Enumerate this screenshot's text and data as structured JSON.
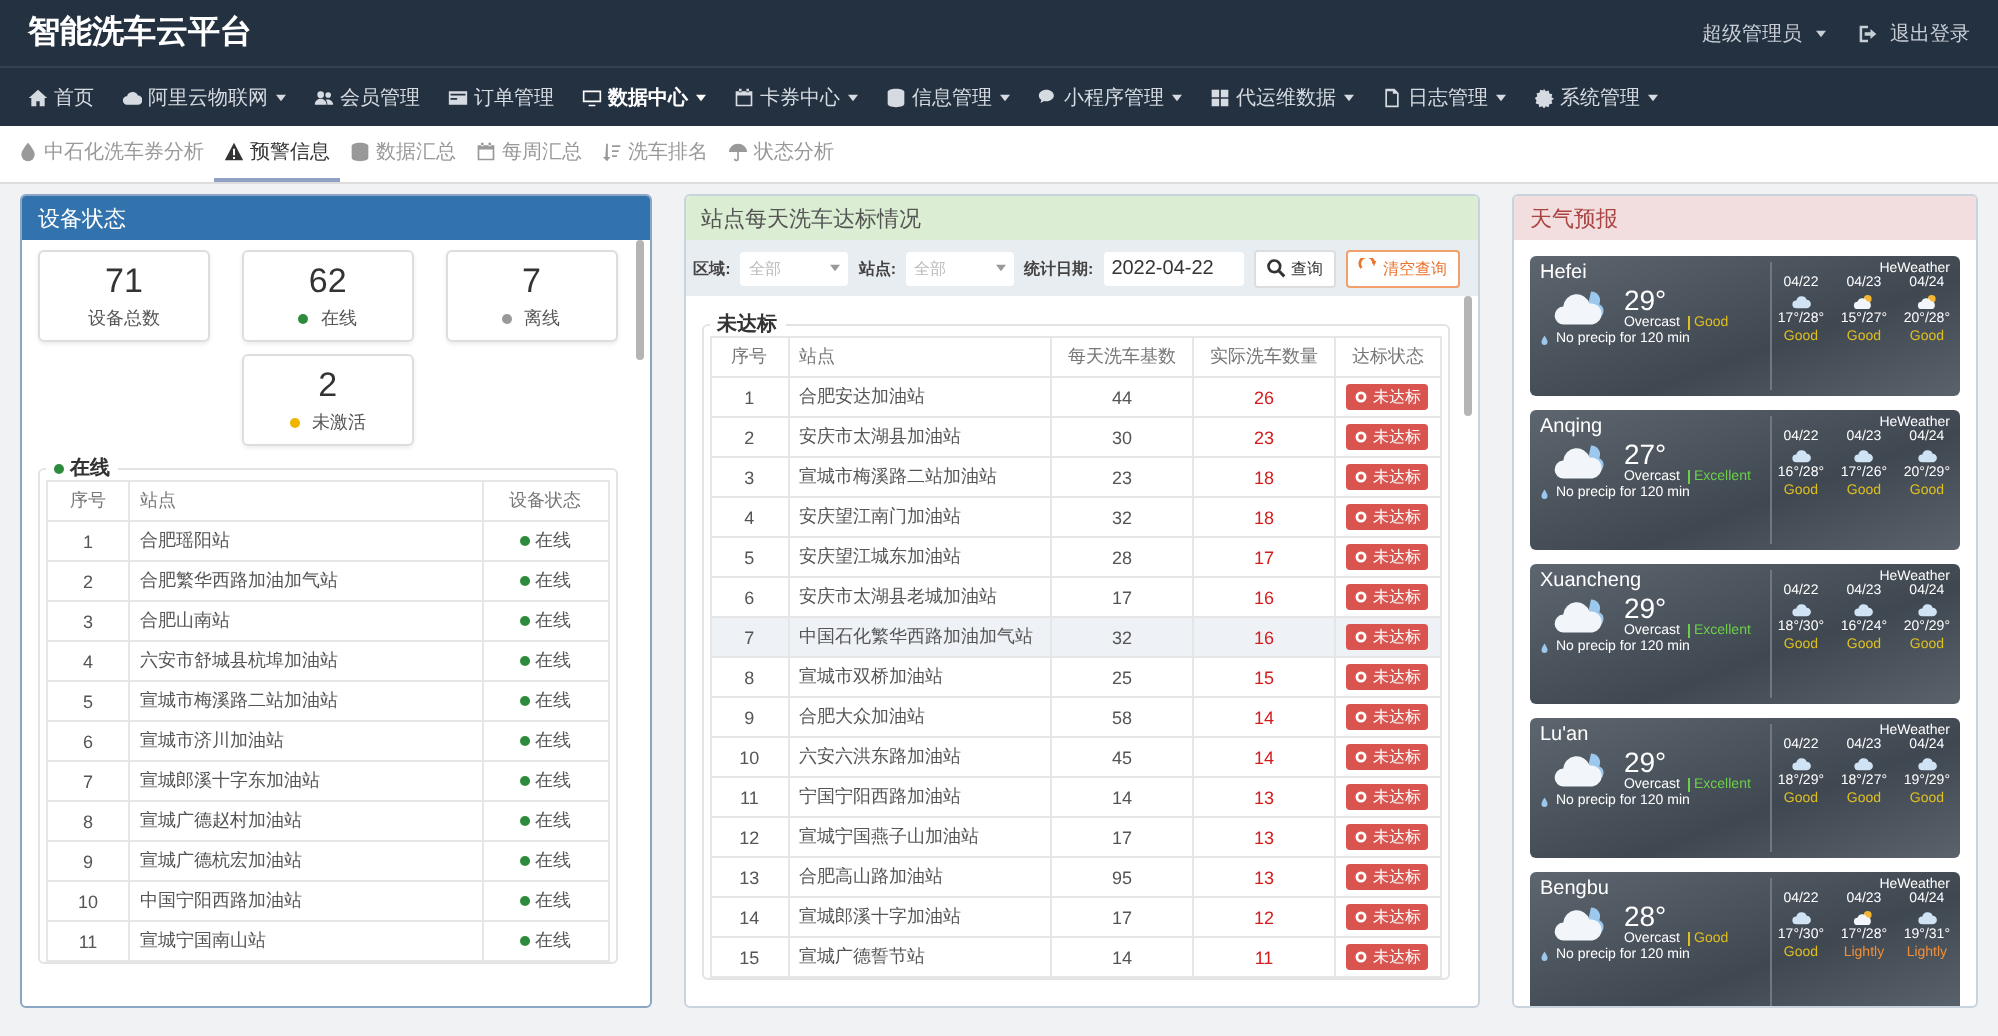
{
  "header": {
    "title": "智能洗车云平台",
    "user": "超级管理员",
    "logout": "退出登录"
  },
  "nav": [
    {
      "label": "首页",
      "active": false,
      "dropdown": false
    },
    {
      "label": "阿里云物联网",
      "active": false,
      "dropdown": true
    },
    {
      "label": "会员管理",
      "active": false,
      "dropdown": false
    },
    {
      "label": "订单管理",
      "active": false,
      "dropdown": false
    },
    {
      "label": "数据中心",
      "active": true,
      "dropdown": true
    },
    {
      "label": "卡券中心",
      "active": false,
      "dropdown": true
    },
    {
      "label": "信息管理",
      "active": false,
      "dropdown": true
    },
    {
      "label": "小程序管理",
      "active": false,
      "dropdown": true
    },
    {
      "label": "代运维数据",
      "active": false,
      "dropdown": true
    },
    {
      "label": "日志管理",
      "active": false,
      "dropdown": true
    },
    {
      "label": "系统管理",
      "active": false,
      "dropdown": true
    }
  ],
  "subtabs": [
    {
      "label": "中石化洗车券分析",
      "selected": false
    },
    {
      "label": "预警信息",
      "selected": true
    },
    {
      "label": "数据汇总",
      "selected": false
    },
    {
      "label": "每周汇总",
      "selected": false
    },
    {
      "label": "洗车排名",
      "selected": false
    },
    {
      "label": "状态分析",
      "selected": false
    }
  ],
  "device_panel": {
    "title": "设备状态",
    "stats": [
      {
        "value": "71",
        "label": "设备总数"
      },
      {
        "value": "62",
        "label": "在线",
        "color": "#2e8b3d"
      },
      {
        "value": "7",
        "label": "离线",
        "color": "#999999"
      },
      {
        "value": "2",
        "label": "未激活",
        "color": "#f0b400"
      }
    ],
    "legend": {
      "label": "在线",
      "color": "#2e8b3d"
    },
    "columns": [
      "序号",
      "站点",
      "设备状态"
    ],
    "rows": [
      {
        "no": "1",
        "station": "合肥瑶阳站",
        "status": "在线"
      },
      {
        "no": "2",
        "station": "合肥繁华西路加油加气站",
        "status": "在线"
      },
      {
        "no": "3",
        "station": "合肥山南站",
        "status": "在线"
      },
      {
        "no": "4",
        "station": "六安市舒城县杭埠加油站",
        "status": "在线"
      },
      {
        "no": "5",
        "station": "宣城市梅溪路二站加油站",
        "status": "在线"
      },
      {
        "no": "6",
        "station": "宣城市济川加油站",
        "status": "在线"
      },
      {
        "no": "7",
        "station": "宣城郎溪十字东加油站",
        "status": "在线"
      },
      {
        "no": "8",
        "station": "宣城广德赵村加油站",
        "status": "在线"
      },
      {
        "no": "9",
        "station": "宣城广德杭宏加油站",
        "status": "在线"
      },
      {
        "no": "10",
        "station": "中国宁阳西路加油站",
        "status": "在线"
      },
      {
        "no": "11",
        "station": "宣城宁国南山站",
        "status": "在线"
      }
    ]
  },
  "standard_panel": {
    "title": "站点每天洗车达标情况",
    "filters": {
      "region_label": "区域:",
      "region_value": "全部",
      "station_label": "站点:",
      "station_value": "全部",
      "date_label": "统计日期:",
      "date_value": "2022-04-22"
    },
    "search_button": "查询",
    "reset_button": "清空查询",
    "legend": "未达标",
    "columns": [
      "序号",
      "站点",
      "每天洗车基数",
      "实际洗车数量",
      "达标状态"
    ],
    "rows": [
      {
        "no": "1",
        "station": "合肥安达加油站",
        "target": "44",
        "actual": "26",
        "status": "未达标",
        "selected": false
      },
      {
        "no": "2",
        "station": "安庆市太湖县加油站",
        "target": "30",
        "actual": "23",
        "status": "未达标",
        "selected": false
      },
      {
        "no": "3",
        "station": "宣城市梅溪路二站加油站",
        "target": "23",
        "actual": "18",
        "status": "未达标",
        "selected": false
      },
      {
        "no": "4",
        "station": "安庆望江南门加油站",
        "target": "32",
        "actual": "18",
        "status": "未达标",
        "selected": false
      },
      {
        "no": "5",
        "station": "安庆望江城东加油站",
        "target": "28",
        "actual": "17",
        "status": "未达标",
        "selected": false
      },
      {
        "no": "6",
        "station": "安庆市太湖县老城加油站",
        "target": "17",
        "actual": "16",
        "status": "未达标",
        "selected": false
      },
      {
        "no": "7",
        "station": "中国石化繁华西路加油加气站",
        "target": "32",
        "actual": "16",
        "status": "未达标",
        "selected": true
      },
      {
        "no": "8",
        "station": "宣城市双桥加油站",
        "target": "25",
        "actual": "15",
        "status": "未达标",
        "selected": false
      },
      {
        "no": "9",
        "station": "合肥大众加油站",
        "target": "58",
        "actual": "14",
        "status": "未达标",
        "selected": false
      },
      {
        "no": "10",
        "station": "六安六洪东路加油站",
        "target": "45",
        "actual": "14",
        "status": "未达标",
        "selected": false
      },
      {
        "no": "11",
        "station": "宁国宁阳西路加油站",
        "target": "14",
        "actual": "13",
        "status": "未达标",
        "selected": false
      },
      {
        "no": "12",
        "station": "宣城宁国燕子山加油站",
        "target": "17",
        "actual": "13",
        "status": "未达标",
        "selected": false
      },
      {
        "no": "13",
        "station": "合肥高山路加油站",
        "target": "95",
        "actual": "13",
        "status": "未达标",
        "selected": false
      },
      {
        "no": "14",
        "station": "宣城郎溪十字加油站",
        "target": "17",
        "actual": "12",
        "status": "未达标",
        "selected": false
      },
      {
        "no": "15",
        "station": "宣城广德誓节站",
        "target": "14",
        "actual": "11",
        "status": "未达标",
        "selected": false
      }
    ]
  },
  "weather_panel": {
    "title": "天气预报",
    "cards": [
      {
        "city": "Hefei",
        "provider": "HeWeather",
        "temp": "29°",
        "condition": "Overcast",
        "aqi": "Good",
        "color": "#e0c020",
        "precip": "No precip for 120 min",
        "days": [
          {
            "date": "04/22",
            "kind": "cloudy",
            "range": "17°/28°",
            "aqi": "Good",
            "color": "#e0c020"
          },
          {
            "date": "04/23",
            "kind": "partly_cloudy",
            "range": "15°/27°",
            "aqi": "Good",
            "color": "#e0c020"
          },
          {
            "date": "04/24",
            "kind": "partly_cloudy",
            "range": "20°/28°",
            "aqi": "Good",
            "color": "#e0c020"
          }
        ]
      },
      {
        "city": "Anqing",
        "provider": "HeWeather",
        "temp": "27°",
        "condition": "Overcast",
        "aqi": "Excellent",
        "color": "#6ccf4a",
        "precip": "No precip for 120 min",
        "days": [
          {
            "date": "04/22",
            "kind": "cloudy",
            "range": "16°/28°",
            "aqi": "Good",
            "color": "#e0c020"
          },
          {
            "date": "04/23",
            "kind": "cloudy",
            "range": "17°/26°",
            "aqi": "Good",
            "color": "#e0c020"
          },
          {
            "date": "04/24",
            "kind": "cloudy",
            "range": "20°/29°",
            "aqi": "Good",
            "color": "#e0c020"
          }
        ]
      },
      {
        "city": "Xuancheng",
        "provider": "HeWeather",
        "temp": "29°",
        "condition": "Overcast",
        "aqi": "Excellent",
        "color": "#6ccf4a",
        "precip": "No precip for 120 min",
        "days": [
          {
            "date": "04/22",
            "kind": "cloudy",
            "range": "18°/30°",
            "aqi": "Good",
            "color": "#e0c020"
          },
          {
            "date": "04/23",
            "kind": "cloudy",
            "range": "16°/24°",
            "aqi": "Good",
            "color": "#e0c020"
          },
          {
            "date": "04/24",
            "kind": "cloudy",
            "range": "20°/29°",
            "aqi": "Good",
            "color": "#e0c020"
          }
        ]
      },
      {
        "city": "Lu'an",
        "provider": "HeWeather",
        "temp": "29°",
        "condition": "Overcast",
        "aqi": "Excellent",
        "color": "#6ccf4a",
        "precip": "No precip for 120 min",
        "days": [
          {
            "date": "04/22",
            "kind": "cloudy",
            "range": "18°/29°",
            "aqi": "Good",
            "color": "#e0c020"
          },
          {
            "date": "04/23",
            "kind": "cloudy",
            "range": "18°/27°",
            "aqi": "Good",
            "color": "#e0c020"
          },
          {
            "date": "04/24",
            "kind": "cloudy",
            "range": "19°/29°",
            "aqi": "Good",
            "color": "#e0c020"
          }
        ]
      },
      {
        "city": "Bengbu",
        "provider": "HeWeather",
        "temp": "28°",
        "condition": "Overcast",
        "aqi": "Good",
        "color": "#e0c020",
        "precip": "No precip for 120 min",
        "days": [
          {
            "date": "04/22",
            "kind": "cloudy",
            "range": "17°/30°",
            "aqi": "Good",
            "color": "#e0c020"
          },
          {
            "date": "04/23",
            "kind": "partly_cloudy",
            "range": "17°/28°",
            "aqi": "Lightly",
            "color": "#f0903a"
          },
          {
            "date": "04/24",
            "kind": "cloudy",
            "range": "19°/31°",
            "aqi": "Lightly",
            "color": "#f0903a"
          }
        ]
      }
    ]
  }
}
